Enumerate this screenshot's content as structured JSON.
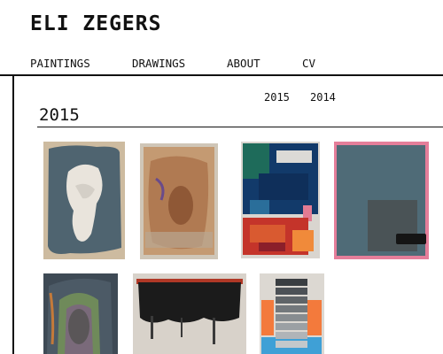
{
  "site": {
    "title": "ELI ZEGERS"
  },
  "nav": {
    "items": [
      "PAINTINGS",
      "DRAWINGS",
      "ABOUT",
      "CV"
    ]
  },
  "years": [
    "2015",
    "2014"
  ],
  "section": {
    "title": "2015"
  },
  "artworks": [
    {
      "name": "painting-thumbnail-1",
      "colors": {
        "main": "#4f6470",
        "accent": "#e9e4dc"
      }
    },
    {
      "name": "painting-thumbnail-2",
      "colors": {
        "main": "#b98a62",
        "accent": "#6a4b8a"
      }
    },
    {
      "name": "painting-thumbnail-3",
      "colors": {
        "main": "#123a6a",
        "accent": "#c4342a"
      }
    },
    {
      "name": "painting-thumbnail-4",
      "colors": {
        "main": "#4f6b77",
        "accent": "#e57e9a"
      }
    },
    {
      "name": "painting-thumbnail-5",
      "colors": {
        "main": "#3e4a55",
        "accent": "#6f8a5a"
      }
    },
    {
      "name": "painting-thumbnail-6",
      "colors": {
        "main": "#1b1b1b",
        "accent": "#b03826"
      }
    },
    {
      "name": "painting-thumbnail-7",
      "colors": {
        "main": "#5f6468",
        "accent": "#f37a3c"
      }
    }
  ]
}
